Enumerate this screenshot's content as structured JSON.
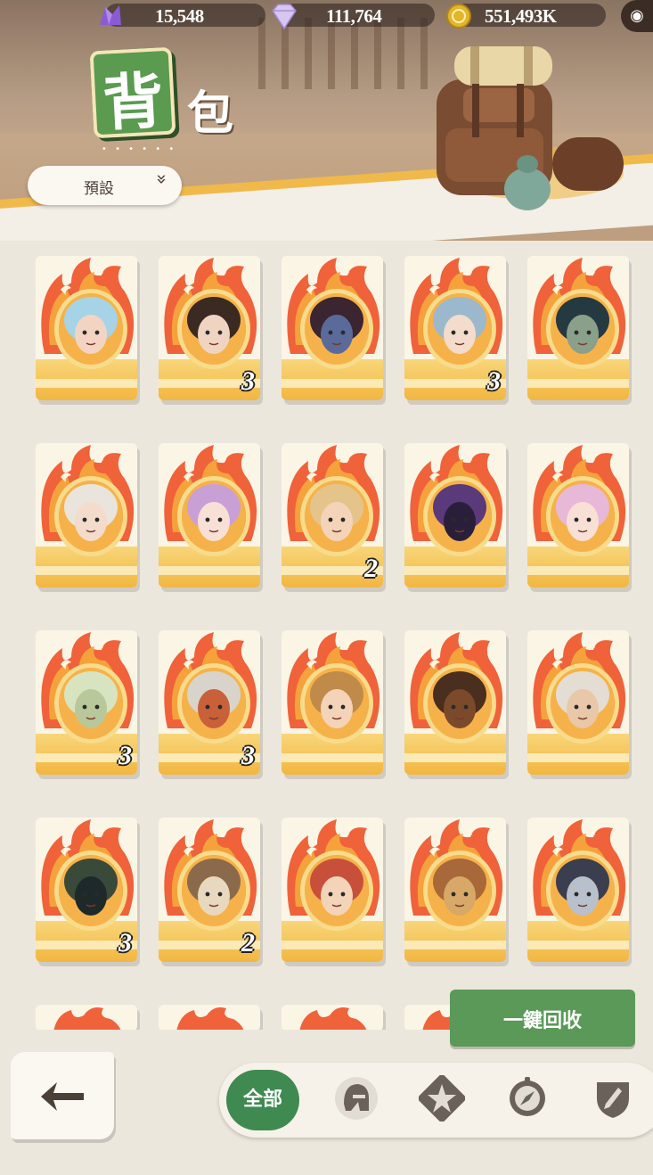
{
  "resources": [
    {
      "name": "purple-crystal",
      "value": "15,548",
      "color": "#8b5bd6"
    },
    {
      "name": "diamond",
      "value": "111,764",
      "color": "#d6c6f0"
    },
    {
      "name": "gold-coin",
      "value": "551,493K",
      "color": "#e3b52a"
    }
  ],
  "title": {
    "char1": "背",
    "char2": "包",
    "dots": "• • • • • •"
  },
  "preset": {
    "label": "預設",
    "chevron": "»"
  },
  "recycle_label": "一鍵回收",
  "filter": {
    "all_label": "全部",
    "icons": [
      "helmet-icon",
      "star-badge-icon",
      "compass-icon",
      "shield-sword-icon"
    ]
  },
  "cards": [
    {
      "portrait": "twin-girls-blue-pink",
      "count": "",
      "skin": "#f3d4c3",
      "hair": "#a6d3e6"
    },
    {
      "portrait": "dark-haired-man-circlet",
      "count": "3",
      "skin": "#f0d4c2",
      "hair": "#3a2a22"
    },
    {
      "portrait": "blue-demon",
      "count": "",
      "skin": "#5a6a9a",
      "hair": "#3a2530"
    },
    {
      "portrait": "silver-haired-youth",
      "count": "3",
      "skin": "#f3dccb",
      "hair": "#9bb8cc"
    },
    {
      "portrait": "dark-teal-hooded",
      "count": "",
      "skin": "#8aa08a",
      "hair": "#243a40"
    },
    {
      "portrait": "white-goat-horns",
      "count": "",
      "skin": "#f3dccb",
      "hair": "#e9e4dc"
    },
    {
      "portrait": "lilac-haired-girl",
      "count": "",
      "skin": "#f8e0d6",
      "hair": "#c9a0d6"
    },
    {
      "portrait": "blonde-youth",
      "count": "2",
      "skin": "#f3d4b8",
      "hair": "#e4c48a"
    },
    {
      "portrait": "purple-mask",
      "count": "",
      "skin": "#2a1f3a",
      "hair": "#5a3a7a"
    },
    {
      "portrait": "pink-haired-girl",
      "count": "",
      "skin": "#f8e0d6",
      "hair": "#e8b8d8"
    },
    {
      "portrait": "green-elf",
      "count": "3",
      "skin": "#b8c89a",
      "hair": "#d8e4c0"
    },
    {
      "portrait": "lion-mask-warrior",
      "count": "3",
      "skin": "#c8603a",
      "hair": "#d8d4cc"
    },
    {
      "portrait": "girl-with-goggles",
      "count": "",
      "skin": "#f3d4b8",
      "hair": "#c08a4a"
    },
    {
      "portrait": "goggled-beast",
      "count": "",
      "skin": "#7a4a2a",
      "hair": "#4a2e1e"
    },
    {
      "portrait": "old-sage",
      "count": "",
      "skin": "#e8c8a8",
      "hair": "#e4ddd4"
    },
    {
      "portrait": "green-visor-robot",
      "count": "3",
      "skin": "#1e2a2a",
      "hair": "#3a4a3a"
    },
    {
      "portrait": "badger-beast",
      "count": "2",
      "skin": "#e8d8c0",
      "hair": "#8a6a4a"
    },
    {
      "portrait": "red-haired-boy",
      "count": "",
      "skin": "#f3d4b8",
      "hair": "#c8503a"
    },
    {
      "portrait": "lion-man",
      "count": "",
      "skin": "#d8a868",
      "hair": "#a8683a"
    },
    {
      "portrait": "pale-ghost-woman",
      "count": "",
      "skin": "#b8c0cc",
      "hair": "#3a3e4e"
    }
  ]
}
